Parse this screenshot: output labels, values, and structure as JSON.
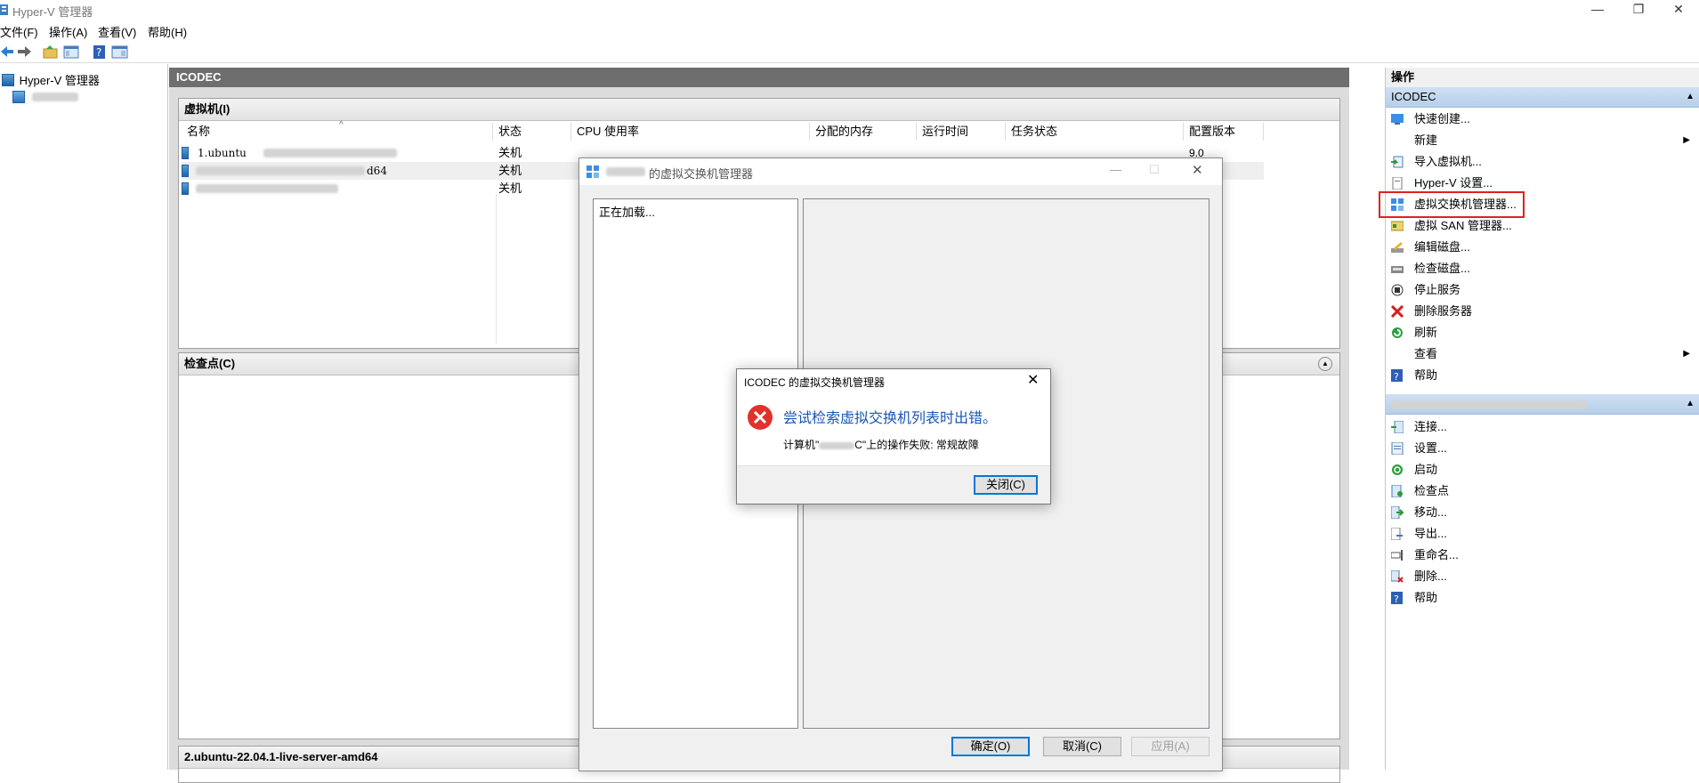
{
  "window": {
    "title": "Hyper-V 管理器",
    "controls": {
      "minimize": "—",
      "restore": "❐",
      "close": "✕"
    }
  },
  "menu": [
    "文件(F)",
    "操作(A)",
    "查看(V)",
    "帮助(H)"
  ],
  "tree": {
    "root": "Hyper-V 管理器"
  },
  "center": {
    "title": "ICODEC",
    "vms": {
      "header": "虚拟机(I)",
      "columns": [
        "名称",
        "状态",
        "CPU 使用率",
        "分配的内存",
        "运行时间",
        "任务状态",
        "配置版本"
      ],
      "rows": [
        {
          "name": "1.ubuntu",
          "status": "关机",
          "version": "9.0"
        },
        {
          "name": "d64",
          "status": "关机",
          "version": ""
        },
        {
          "name": "",
          "status": "关机",
          "version": ""
        }
      ]
    },
    "checkpoints": {
      "header": "检查点(C)"
    },
    "details": {
      "header": "2.ubuntu-22.04.1-live-server-amd64"
    }
  },
  "actions": {
    "title": "操作",
    "group1": "ICODEC",
    "items1": [
      "快速创建...",
      "新建",
      "导入虚拟机...",
      "Hyper-V 设置...",
      "虚拟交换机管理器...",
      "虚拟 SAN 管理器...",
      "编辑磁盘...",
      "检查磁盘...",
      "停止服务",
      "删除服务器",
      "刷新",
      "查看",
      "帮助"
    ],
    "items2": [
      "连接...",
      "设置...",
      "启动",
      "检查点",
      "移动...",
      "导出...",
      "重命名...",
      "删除...",
      "帮助"
    ]
  },
  "switch_dialog": {
    "title": "的虚拟交换机管理器",
    "loading": "正在加载...",
    "ok": "确定(O)",
    "cancel": "取消(C)",
    "apply": "应用(A)"
  },
  "error_dialog": {
    "title": "ICODEC 的虚拟交换机管理器",
    "heading": "尝试检索虚拟交换机列表时出错。",
    "detail_prefix": "计算机\"",
    "detail_suffix": "C\"上的操作失败: 常规故障",
    "close": "关闭(C)"
  },
  "colors": {
    "heading_blue": "#1a56b4",
    "error_red": "#e0322b",
    "highlight": "#e02020"
  }
}
